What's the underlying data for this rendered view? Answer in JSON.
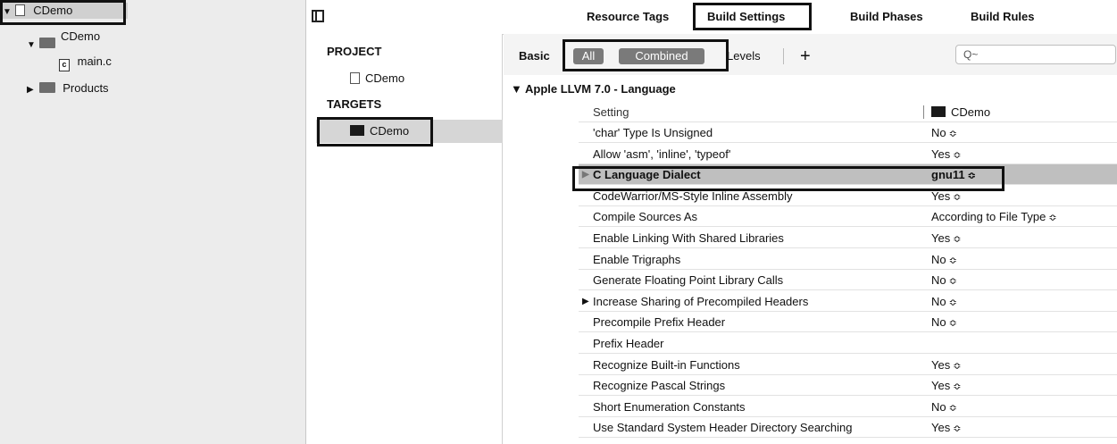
{
  "navigator": {
    "project": "CDemo",
    "group": "CDemo",
    "file": "main.c",
    "file_glyph": "c",
    "products": "Products"
  },
  "tabs": {
    "resource_tags": "Resource Tags",
    "build_settings": "Build Settings",
    "build_phases": "Build Phases",
    "build_rules": "Build Rules"
  },
  "targets_panel": {
    "project_header": "PROJECT",
    "project_item": "CDemo",
    "targets_header": "TARGETS",
    "target_item": "CDemo"
  },
  "filter": {
    "basic": "Basic",
    "all": "All",
    "combined": "Combined",
    "levels": "Levels",
    "add": "+",
    "search_placeholder": "Q~"
  },
  "settings": {
    "group_title": "▼ Apple LLVM 7.0 - Language",
    "header_setting": "Setting",
    "header_target": "CDemo",
    "stepper_glyph": "≎",
    "rows": [
      {
        "name": "'char' Type Is Unsigned",
        "value": "No"
      },
      {
        "name": "Allow 'asm', 'inline', 'typeof'",
        "value": "Yes"
      },
      {
        "name": "C Language Dialect",
        "value": "gnu11"
      },
      {
        "name": "CodeWarrior/MS-Style Inline Assembly",
        "value": "Yes"
      },
      {
        "name": "Compile Sources As",
        "value": "According to File Type"
      },
      {
        "name": "Enable Linking With Shared Libraries",
        "value": "Yes"
      },
      {
        "name": "Enable Trigraphs",
        "value": "No"
      },
      {
        "name": "Generate Floating Point Library Calls",
        "value": "No"
      },
      {
        "name": "Increase Sharing of Precompiled Headers",
        "value": "No"
      },
      {
        "name": "Precompile Prefix Header",
        "value": "No"
      },
      {
        "name": "Prefix Header",
        "value": ""
      },
      {
        "name": "Recognize Built-in Functions",
        "value": "Yes"
      },
      {
        "name": "Recognize Pascal Strings",
        "value": "Yes"
      },
      {
        "name": "Short Enumeration Constants",
        "value": "No"
      },
      {
        "name": "Use Standard System Header Directory Searching",
        "value": "Yes"
      }
    ]
  }
}
